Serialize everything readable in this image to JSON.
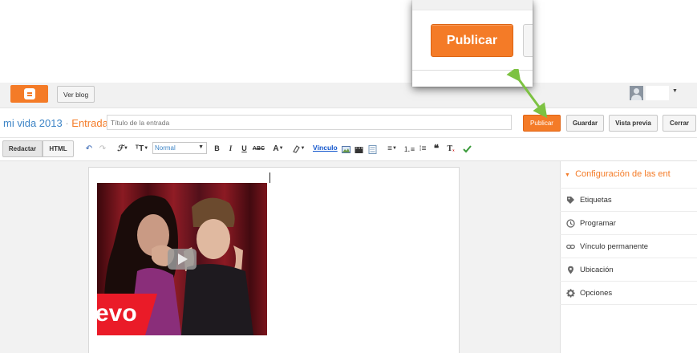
{
  "topbar": {
    "logo": "blogger-logo",
    "view_blog_label": "Ver blog"
  },
  "header": {
    "blog_name": "mi vida 2013",
    "separator": " · ",
    "section": "Entrada",
    "title_placeholder": "Título de la entrada",
    "buttons": {
      "publish": "Publicar",
      "save": "Guardar",
      "preview": "Vista previa",
      "close": "Cerrar"
    }
  },
  "toolbar": {
    "mode_compose": "Redactar",
    "mode_html": "HTML",
    "font_size_value": "Normal",
    "link_label": "Vínculo"
  },
  "sidebar": {
    "header": "Configuración de las ent",
    "items": [
      {
        "label": "Etiquetas",
        "icon": "tag-icon"
      },
      {
        "label": "Programar",
        "icon": "clock-icon"
      },
      {
        "label": "Vínculo permanente",
        "icon": "link-icon"
      },
      {
        "label": "Ubicación",
        "icon": "pin-icon"
      },
      {
        "label": "Opciones",
        "icon": "gear-icon"
      }
    ]
  },
  "zoom_callout": {
    "publish_label": "Publicar"
  },
  "video": {
    "watermark": "evo"
  },
  "colors": {
    "accent": "#f47b27",
    "link_blue": "#3d84c6",
    "arrow_green": "#7dc242"
  }
}
